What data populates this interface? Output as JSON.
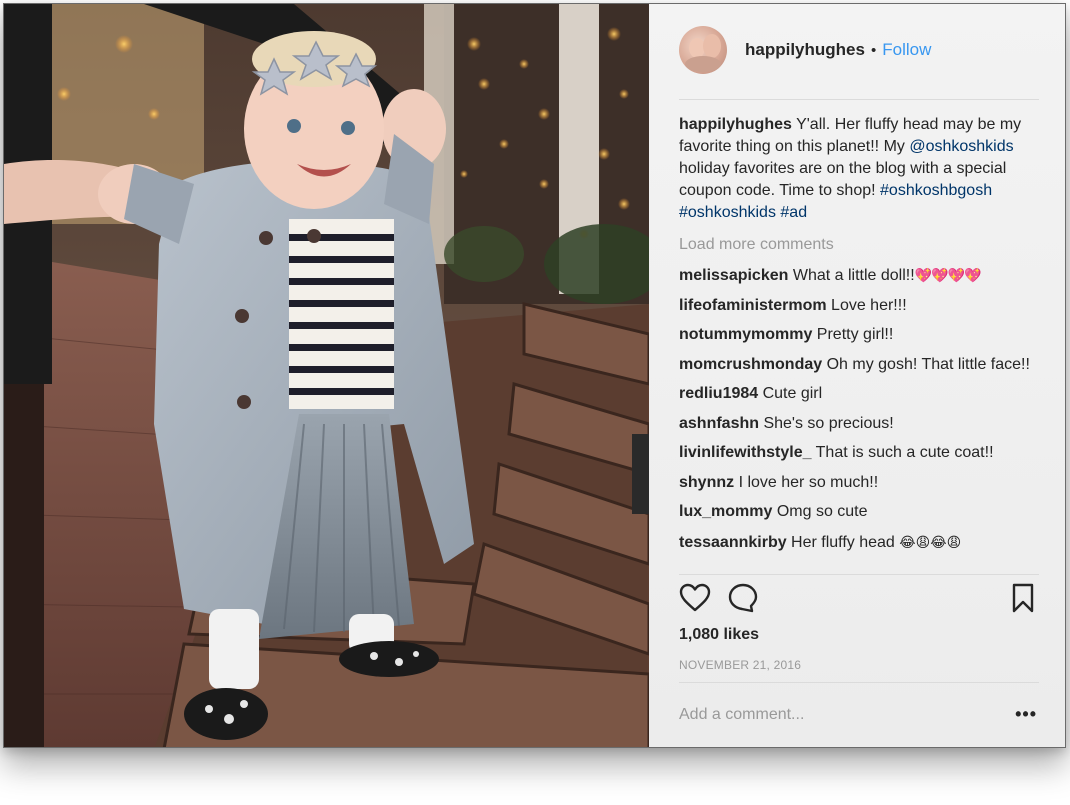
{
  "post": {
    "username": "happilyhughes",
    "separator": "•",
    "follow_label": "Follow",
    "caption": {
      "username": "happilyhughes",
      "text_1": " Y'all. Her fluffy head may be my favorite thing on this planet!! My ",
      "mention": "@oshkoshkids",
      "text_2": " holiday favorites are on the blog with a special coupon code. Time to shop! ",
      "hashtag_1": "#oshkoshbgosh",
      "hashtag_2": "#oshkoshkids",
      "hashtag_3": "#ad"
    },
    "load_more_label": "Load more comments",
    "comments": [
      {
        "user": "melissapicken",
        "text": " What a little doll!!",
        "emoji": "💖💖💖💖"
      },
      {
        "user": "lifeofaministermom",
        "text": " Love her!!!"
      },
      {
        "user": "notummymommy",
        "text": " Pretty girl!!"
      },
      {
        "user": "momcrushmonday",
        "text": " Oh my gosh! That little face!!"
      },
      {
        "user": "redliu1984",
        "text": " Cute girl"
      },
      {
        "user": "ashnfashn",
        "text": " She's so precious!"
      },
      {
        "user": "livinlifewithstyle_",
        "text": " That is such a cute coat!!"
      },
      {
        "user": "shynnz",
        "text": " I love her so much!!"
      },
      {
        "user": "lux_mommy",
        "text": " Omg so cute"
      },
      {
        "user": "tessaannkirby",
        "text": " Her fluffy head ",
        "emoji": "😂😩😂😩"
      }
    ],
    "likes": "1,080 likes",
    "date": "NOVEMBER 21, 2016",
    "add_comment_placeholder": "Add a comment...",
    "more_icon": "more-options-icon",
    "icons": [
      "heart-icon",
      "comment-icon",
      "bookmark-icon"
    ]
  },
  "colors": {
    "link_blue": "#3897f0",
    "hashtag": "#003569",
    "muted": "#999999",
    "text": "#262626",
    "panel_bg": "#efefef"
  }
}
